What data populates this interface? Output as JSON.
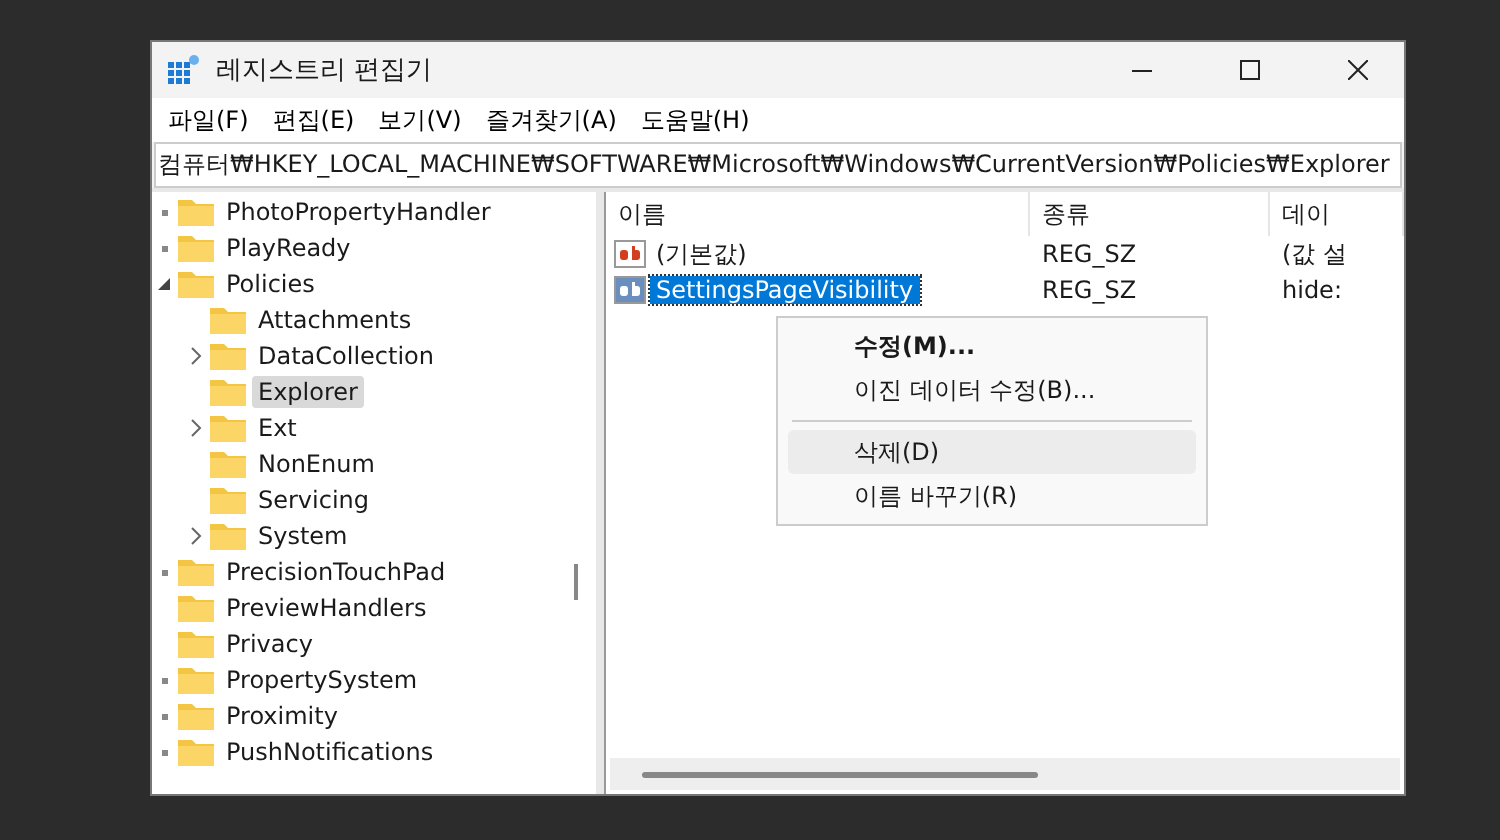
{
  "window": {
    "title": "레지스트리 편집기"
  },
  "menu": [
    {
      "label": "파일(F)"
    },
    {
      "label": "편집(E)"
    },
    {
      "label": "보기(V)"
    },
    {
      "label": "즐겨찾기(A)"
    },
    {
      "label": "도움말(H)"
    }
  ],
  "address": "컴퓨터₩HKEY_LOCAL_MACHINE₩SOFTWARE₩Microsoft₩Windows₩CurrentVersion₩Policies₩Explorer",
  "tree": [
    {
      "label": "PhotoPropertyHandler",
      "selected": false,
      "expandable": true,
      "expanded": false
    },
    {
      "label": "PlayReady",
      "selected": false,
      "expandable": true,
      "expanded": false
    },
    {
      "label": "Policies",
      "selected": false,
      "expandable": true,
      "expanded": true,
      "children": [
        {
          "label": "Attachments",
          "selected": false,
          "expandable": false
        },
        {
          "label": "DataCollection",
          "selected": false,
          "expandable": true,
          "expanded": false
        },
        {
          "label": "Explorer",
          "selected": true,
          "expandable": false
        },
        {
          "label": "Ext",
          "selected": false,
          "expandable": true,
          "expanded": false
        },
        {
          "label": "NonEnum",
          "selected": false,
          "expandable": false
        },
        {
          "label": "Servicing",
          "selected": false,
          "expandable": false
        },
        {
          "label": "System",
          "selected": false,
          "expandable": true,
          "expanded": false
        }
      ]
    },
    {
      "label": "PrecisionTouchPad",
      "selected": false,
      "expandable": true,
      "expanded": false
    },
    {
      "label": "PreviewHandlers",
      "selected": false,
      "expandable": false
    },
    {
      "label": "Privacy",
      "selected": false,
      "expandable": false
    },
    {
      "label": "PropertySystem",
      "selected": false,
      "expandable": true,
      "expanded": false
    },
    {
      "label": "Proximity",
      "selected": false,
      "expandable": true,
      "expanded": false
    },
    {
      "label": "PushNotifications",
      "selected": false,
      "expandable": true,
      "expanded": false
    }
  ],
  "values": {
    "columns": [
      "이름",
      "종류",
      "데이"
    ],
    "rows": [
      {
        "name": "(기본값)",
        "type": "REG_SZ",
        "data": "(값 설",
        "selected": false
      },
      {
        "name": "SettingsPageVisibility",
        "type": "REG_SZ",
        "data": "hide:",
        "selected": true
      }
    ]
  },
  "context_menu": [
    {
      "kind": "item",
      "label": "수정(M)...",
      "bold": true,
      "highlighted": false
    },
    {
      "kind": "item",
      "label": "이진 데이터 수정(B)...",
      "bold": false,
      "highlighted": false
    },
    {
      "kind": "separator"
    },
    {
      "kind": "item",
      "label": "삭제(D)",
      "bold": false,
      "highlighted": true
    },
    {
      "kind": "item",
      "label": "이름 바꾸기(R)",
      "bold": false,
      "highlighted": false
    }
  ]
}
